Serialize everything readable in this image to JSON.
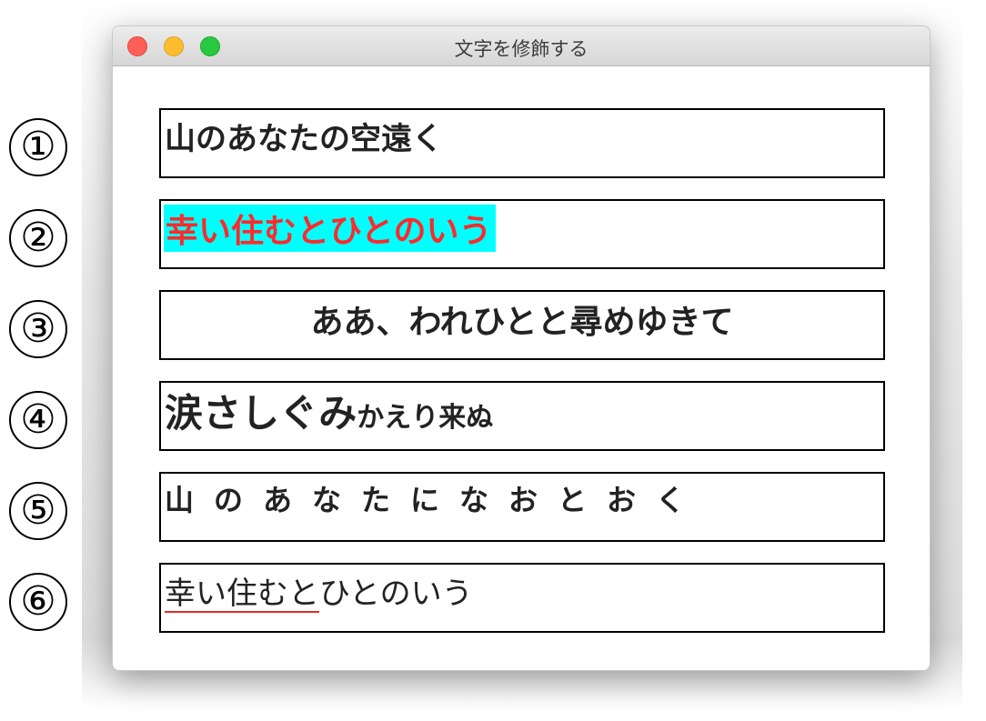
{
  "window": {
    "title": "文字を修飾する"
  },
  "markers": [
    "①",
    "②",
    "③",
    "④",
    "⑤",
    "⑥"
  ],
  "rows": [
    {
      "text": "山のあなたの空遠く"
    },
    {
      "text": "幸い住むとひとのいう",
      "color": "#ff2a2a",
      "highlight": "#00ffff"
    },
    {
      "text": "ああ、われひとと尋めゆきて",
      "align": "center"
    },
    {
      "large": "涙さしぐみ",
      "small": "かえり来ぬ"
    },
    {
      "text": "山のあなたになおとおく"
    },
    {
      "underlined": "幸い住むと",
      "rest": "ひとのいう",
      "underline_color": "#e32a2a"
    }
  ]
}
